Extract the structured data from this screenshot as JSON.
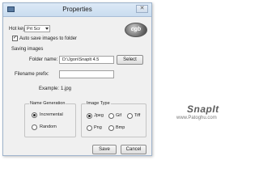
{
  "window": {
    "title": "Properties",
    "close_symbol": "✕"
  },
  "hotkey": {
    "label": "Hot key:",
    "value": "Prt Scr"
  },
  "autosave": {
    "label": "Auto save images to folder",
    "checked": true,
    "check_glyph": "✓"
  },
  "logo": {
    "text": "cgb"
  },
  "saving": {
    "section_label": "Saving images",
    "folder_label": "Folder name:",
    "folder_value": "D:\\Jgon\\Snaplt 4.5",
    "select_button": "Select",
    "prefix_label": "Filename prefix:",
    "prefix_value": "",
    "example_label": "Example:",
    "example_value": "1.jpg"
  },
  "name_generation": {
    "title": "Name Generation",
    "options": [
      {
        "label": "Incremental",
        "selected": true
      },
      {
        "label": "Random",
        "selected": false
      }
    ]
  },
  "image_type": {
    "title": "Image Type",
    "options": [
      {
        "label": "Jpeg",
        "selected": true
      },
      {
        "label": "Gif",
        "selected": false
      },
      {
        "label": "Tiff",
        "selected": false
      },
      {
        "label": "Png",
        "selected": false
      },
      {
        "label": "Bmp",
        "selected": false
      }
    ]
  },
  "buttons": {
    "save": "Save",
    "cancel": "Cancel"
  },
  "watermark": {
    "brand": "SnapIt",
    "site": "www.Patoghu.com"
  }
}
